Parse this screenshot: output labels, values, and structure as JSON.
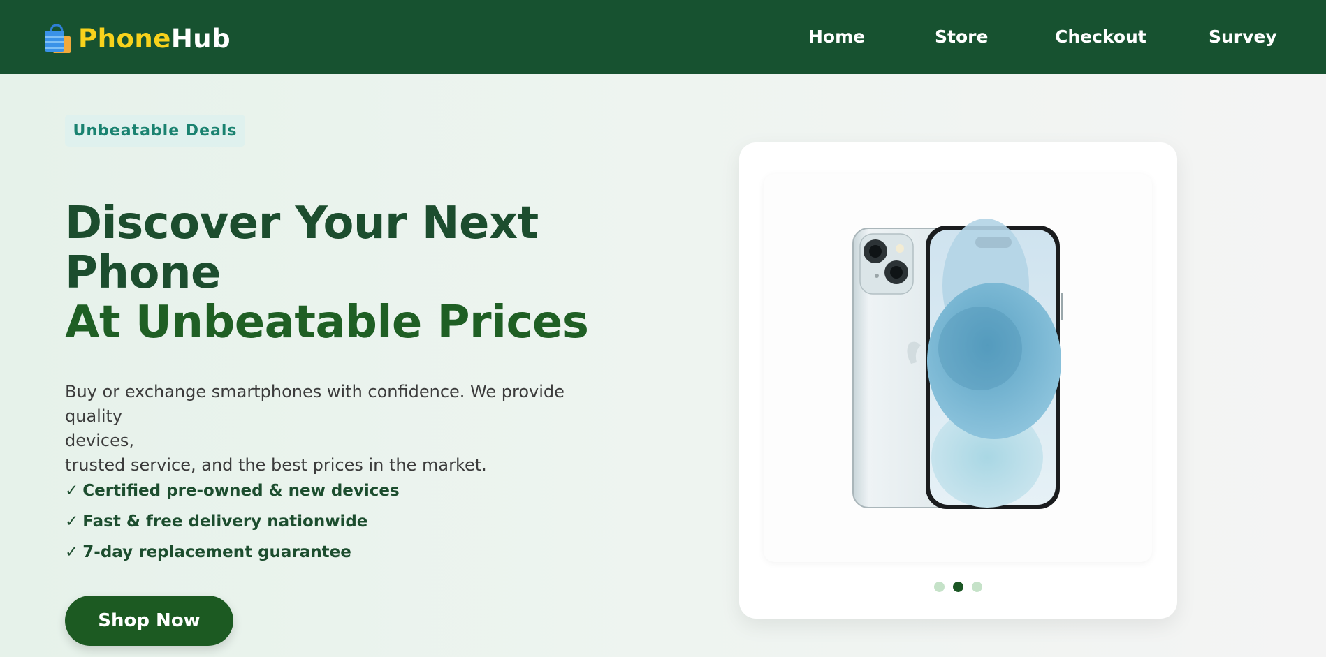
{
  "brand": {
    "name_part1": "Phone",
    "name_part2": "Hub",
    "icon": "shopping-bag-icon"
  },
  "nav": {
    "links": [
      {
        "label": "Home"
      },
      {
        "label": "Store"
      },
      {
        "label": "Checkout"
      },
      {
        "label": "Survey"
      }
    ]
  },
  "hero": {
    "badge": "Unbeatable Deals",
    "headline": {
      "line1": "Discover Your Next",
      "line2": "Phone",
      "line3": "At Unbeatable Prices"
    },
    "description": {
      "line1": "Buy or exchange smartphones with confidence. We provide quality",
      "line2": "devices,",
      "line3": "trusted service, and the best prices in the market."
    },
    "features": [
      "Certified pre-owned & new devices",
      "Fast & free delivery nationwide",
      "7-day replacement guarantee"
    ],
    "check_glyph": "✓",
    "cta_label": "Shop Now"
  },
  "carousel": {
    "slide_image": "smartphone-image",
    "slide_count": 3,
    "active_index": 1
  },
  "colors": {
    "header_bg": "#175230",
    "brand_accent": "#f8d21c",
    "headline": "#1c4d2e",
    "cta_bg": "#1c5a22",
    "badge_bg": "#dff1ee",
    "badge_text": "#1a8270"
  }
}
